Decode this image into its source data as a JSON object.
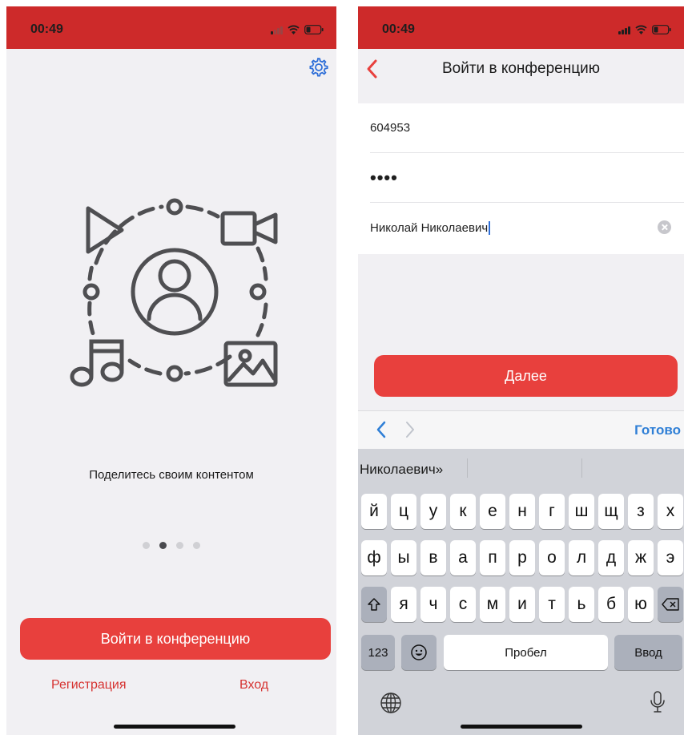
{
  "left_screen": {
    "status_time": "00:49",
    "settings_icon": "gear-icon",
    "caption": "Поделитесь своим контентом",
    "pager": {
      "count": 4,
      "active": 1
    },
    "join_button": "Войти в конференцию",
    "register_link": "Регистрация",
    "login_link": "Вход"
  },
  "right_screen": {
    "status_time": "00:49",
    "title": "Войти в конференцию",
    "fields": {
      "conference_id": "604953",
      "password_mask": "••••",
      "display_name": "Николай Николаевич"
    },
    "next_button": "Далее",
    "keyboard": {
      "done_label": "Готово",
      "suggestion": "Николаевич»",
      "row1": [
        "й",
        "ц",
        "у",
        "к",
        "е",
        "н",
        "г",
        "ш",
        "щ",
        "з",
        "х"
      ],
      "row2": [
        "ф",
        "ы",
        "в",
        "а",
        "п",
        "р",
        "о",
        "л",
        "д",
        "ж",
        "э"
      ],
      "row3": [
        "я",
        "ч",
        "с",
        "м",
        "и",
        "т",
        "ь",
        "б",
        "ю"
      ],
      "numbers_key": "123",
      "space_key": "Пробел",
      "return_key": "Ввод"
    }
  },
  "colors": {
    "status_bar": "#cd2a2a",
    "accent": "#e8403d",
    "link": "#d63331",
    "ios_blue": "#2f7fd6",
    "icon_gray": "#4f4f52",
    "background": "#f1f0f3"
  }
}
